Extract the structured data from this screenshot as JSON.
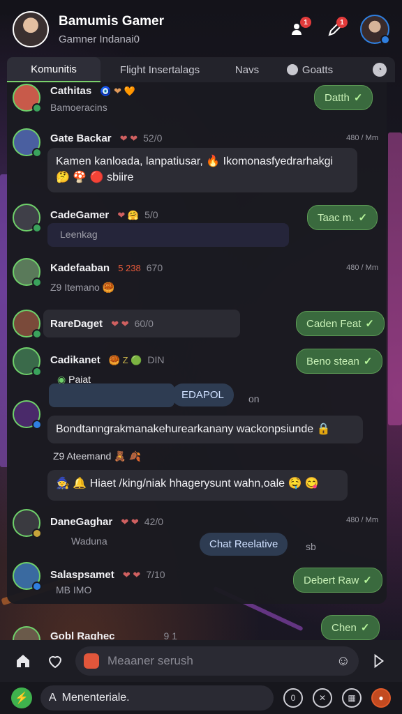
{
  "header": {
    "name": "Bamumis Gamer",
    "subtitle": "Gamner Indanai0",
    "notif_badge": "1",
    "edit_badge": "1"
  },
  "tabs": [
    {
      "label": "Komunitis",
      "active": true
    },
    {
      "label": "Flight Insertalags",
      "active": false
    },
    {
      "label": "Navs",
      "active": false
    },
    {
      "label": "Goatts",
      "active": false
    }
  ],
  "rows": [
    {
      "name": "Cathitas",
      "meta": "🧿 ❤ 🧡",
      "sub": "Bamoeracins",
      "pill": "Datth"
    },
    {
      "name": "Gate Backar",
      "meta": "❤ ❤",
      "count": "52/0",
      "time": "480 / Mm",
      "message": "Kamen kanloada, lanpatiusar, 🔥 Ikomonasfyedrarhakgi 🤔 🍄 🔴 sbiire"
    },
    {
      "name": "CadeGamer",
      "meta": "❤ 🤗",
      "count": "5/0",
      "sub": "Leenkag",
      "pill": "Taac m."
    },
    {
      "name": "Kadefaaban",
      "meta": "5 238",
      "count": "670",
      "time": "480 / Mm",
      "sub": "Z9 Itemano 🥮"
    },
    {
      "name": "RareDaget",
      "meta": "❤ ❤",
      "count": "60/0",
      "pill": "Caden Feat"
    },
    {
      "name": "Cadikanet",
      "meta": "🥮 Z 🟢",
      "count": "DIN",
      "sub": "Paiat",
      "pill": "Beno stean",
      "chip": "EDAPOL",
      "chip_suffix": "on"
    },
    {
      "message": "Bondtanngrakmanakehurearkanany wackonpsiunde 🔒",
      "sub": "Z9 Ateemand 🧸 🍂"
    },
    {
      "message": "🧙 🔔 Hiaet /king/niak hhagerysunt wahn,oale 🤤 😋"
    },
    {
      "name": "DaneGaghar",
      "meta": "❤ ❤",
      "count": "42/0",
      "time": "480 / Mm",
      "sub": "Waduna",
      "chip": "Chat Reelative",
      "chip_suffix": "sb"
    },
    {
      "name": "Salaspsamet",
      "meta": "❤ ❤",
      "count": "7/10",
      "sub": "MB IMO",
      "pill": "Debert Raw"
    },
    {
      "name": "Gobl Raghec",
      "count": "9 1",
      "pill": "Chen"
    }
  ],
  "bottom": {
    "placeholder": "Meaaner serush",
    "compose_label": "Menenteriale."
  }
}
